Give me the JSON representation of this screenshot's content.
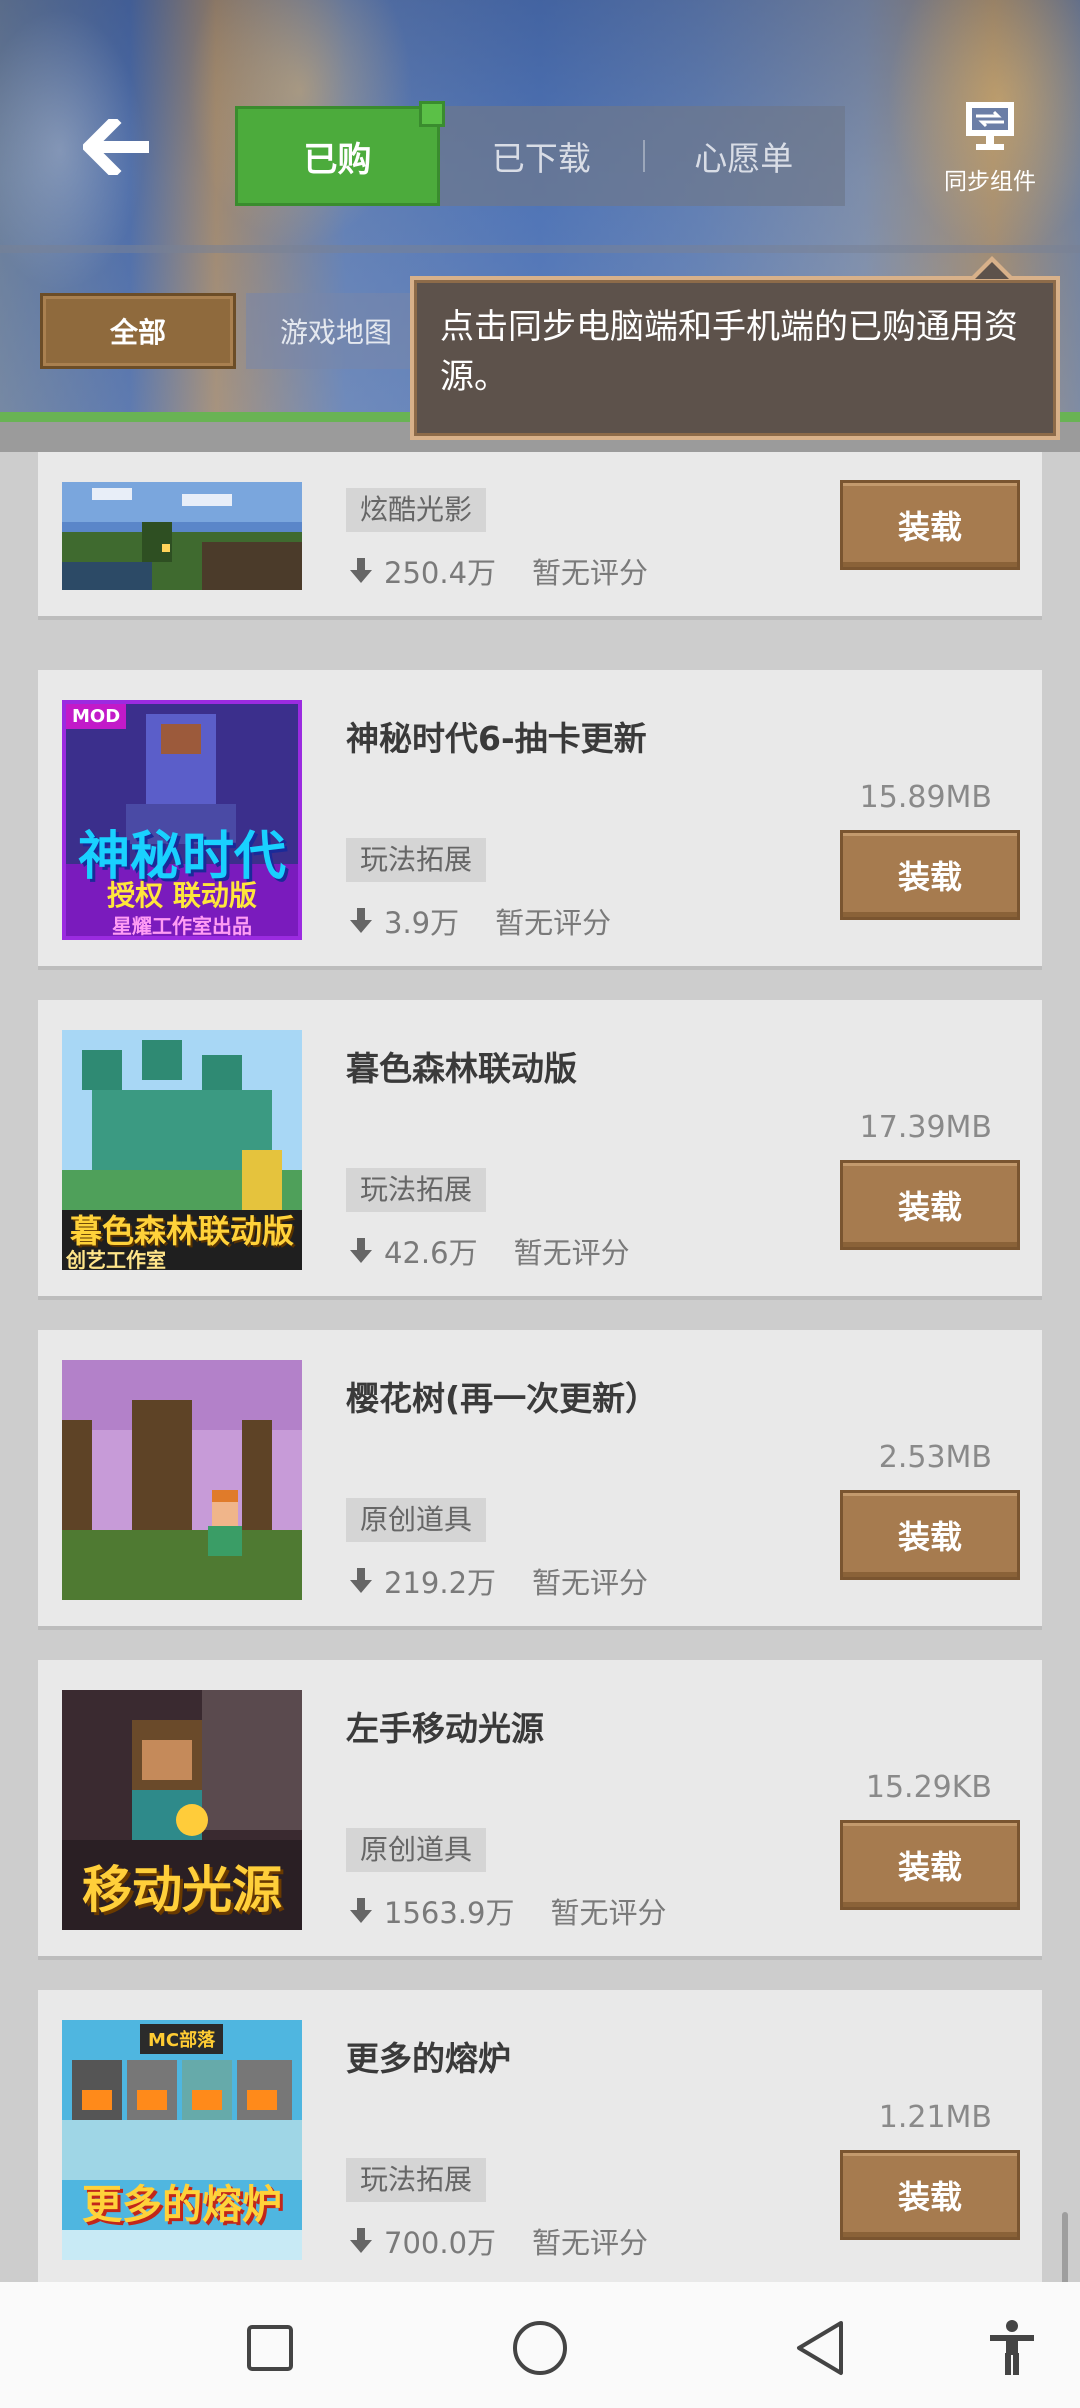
{
  "header": {
    "tabs": [
      {
        "label": "已购",
        "active": true
      },
      {
        "label": "已下载",
        "active": false
      },
      {
        "label": "心愿单",
        "active": false
      }
    ],
    "sync_label": "同步组件",
    "filters": [
      {
        "label": "全部",
        "active": true
      },
      {
        "label": "游戏地图",
        "active": false
      }
    ],
    "tooltip": "点击同步电脑端和手机端的已购通用资源。"
  },
  "items": [
    {
      "title": "",
      "size": "",
      "tag": "炫酷光影",
      "downloads": "250.4万",
      "rating": "暂无评分",
      "button": "装载"
    },
    {
      "title": "神秘时代6-抽卡更新",
      "size": "15.89MB",
      "tag": "玩法拓展",
      "downloads": "3.9万",
      "rating": "暂无评分",
      "button": "装载",
      "thumb_text": "神秘时代",
      "thumb_sub": "授权 联动版",
      "thumb_foot": "星耀工作室出品",
      "thumb_badge": "MOD"
    },
    {
      "title": "暮色森林联动版",
      "size": "17.39MB",
      "tag": "玩法拓展",
      "downloads": "42.6万",
      "rating": "暂无评分",
      "button": "装载",
      "thumb_text": "暮色森林联动版",
      "thumb_foot": "创艺工作室"
    },
    {
      "title": "樱花树(再一次更新）",
      "size": "2.53MB",
      "tag": "原创道具",
      "downloads": "219.2万",
      "rating": "暂无评分",
      "button": "装载"
    },
    {
      "title": "左手移动光源",
      "size": "15.29KB",
      "tag": "原创道具",
      "downloads": "1563.9万",
      "rating": "暂无评分",
      "button": "装载",
      "thumb_text": "移动光源"
    },
    {
      "title": "更多的熔炉",
      "size": "1.21MB",
      "tag": "玩法拓展",
      "downloads": "700.0万",
      "rating": "暂无评分",
      "button": "装载",
      "thumb_text": "更多的熔炉",
      "thumb_badge": "MC部落"
    }
  ],
  "colors": {
    "accent_green": "#4cab3c",
    "load_button": "#a67b4f",
    "tooltip_bg": "#5d524b",
    "tooltip_border": "#d8b18a"
  }
}
